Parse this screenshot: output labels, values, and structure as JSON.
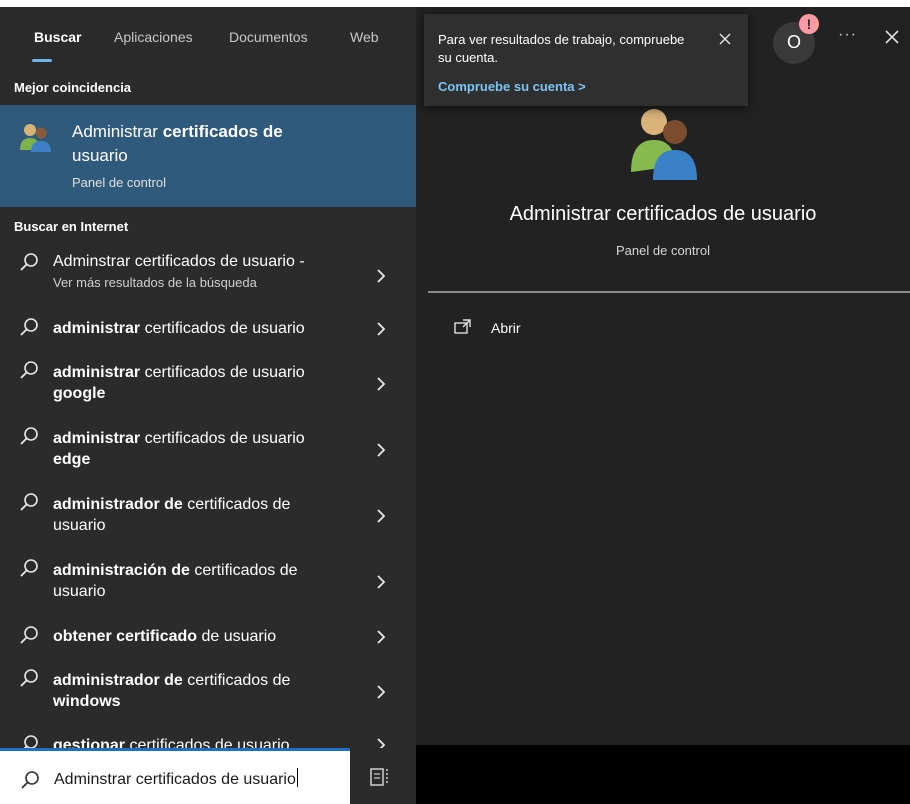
{
  "tabs": [
    {
      "label": "Buscar",
      "active": true
    },
    {
      "label": "Aplicaciones",
      "active": false
    },
    {
      "label": "Documentos",
      "active": false
    },
    {
      "label": "Web",
      "active": false
    }
  ],
  "best_match": {
    "header": "Mejor coincidencia",
    "title_plain": "Administrar ",
    "title_bold": "certificados de",
    "title_line2": "usuario",
    "subtitle": "Panel de control",
    "icon": "users-icon"
  },
  "web_section": {
    "header": "Buscar en Internet",
    "results": [
      {
        "bold": "",
        "text": "Adminstrar certificados de usuario -",
        "sub": "Ver más resultados de la búsqueda"
      },
      {
        "bold": "administrar",
        "text": " certificados de usuario",
        "sub": ""
      },
      {
        "bold": "administrar",
        "text": " certificados de usuario",
        "line2_bold": "google"
      },
      {
        "bold": "administrar",
        "text": " certificados de usuario",
        "line2_bold": "edge"
      },
      {
        "bold": "administrador de",
        "text": " certificados de",
        "line2_plain": "usuario"
      },
      {
        "bold": "administración de",
        "text": " certificados de",
        "line2_plain": "usuario"
      },
      {
        "bold": "obtener certificado",
        "text": " de usuario",
        "sub": ""
      },
      {
        "bold": "administrador de",
        "text": " certificados de",
        "line2_bold": "windows"
      },
      {
        "bold": "gestionar",
        "text": " certificados de usuario",
        "sub": ""
      }
    ]
  },
  "search": {
    "value": "Adminstrar certificados de usuario"
  },
  "preview": {
    "title": "Administrar certificados de usuario",
    "subtitle": "Panel de control",
    "actions": [
      {
        "label": "Abrir",
        "icon": "open-window-icon"
      }
    ]
  },
  "toast": {
    "message": "Para ver resultados de trabajo, compruebe su cuenta.",
    "link": "Compruebe su cuenta >"
  },
  "account": {
    "letter": "O",
    "badge": "!"
  },
  "more": "···",
  "colors": {
    "accent": "#2f5a7b",
    "link": "#7cc4f2",
    "badge": "#ff9aa5",
    "tab_underline": "#6cb4e6"
  }
}
